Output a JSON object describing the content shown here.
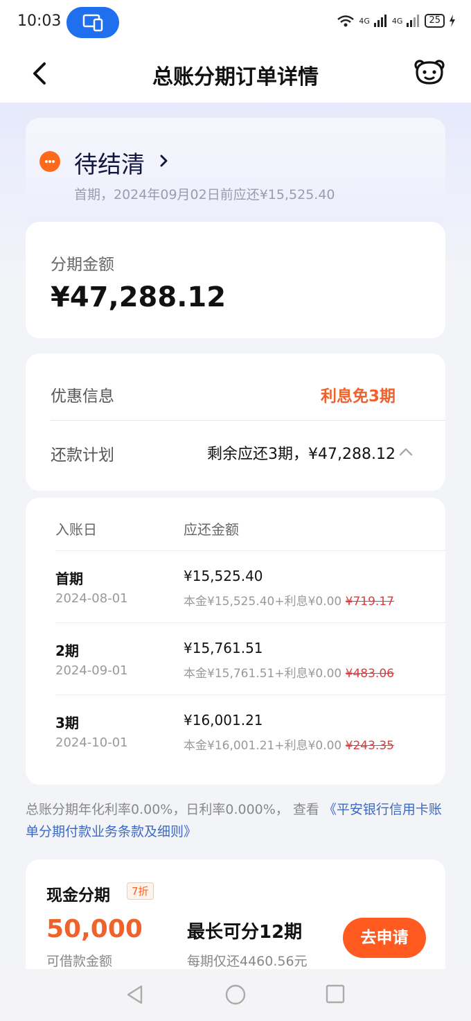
{
  "status_bar": {
    "time": "10:03",
    "battery": "25",
    "network1": "4G",
    "network2": "4G"
  },
  "header": {
    "title": "总账分期订单详情"
  },
  "status_card": {
    "status": "待结清",
    "subtitle": "首期，2024年09月02日前应还¥15,525.40"
  },
  "amount_card": {
    "label": "分期金额",
    "value": "¥47,288.12"
  },
  "info_card": {
    "promo_label": "优惠信息",
    "promo_value": "利息免3期",
    "plan_label": "还款计划",
    "plan_value": "剩余应还3期，¥47,288.12"
  },
  "schedule": {
    "col_date": "入账日",
    "col_amount": "应还金额",
    "rows": [
      {
        "period": "首期",
        "date": "2024-08-01",
        "amount": "¥15,525.40",
        "detail": "本金¥15,525.40+利息¥0.00",
        "original_interest": "¥719.17"
      },
      {
        "period": "2期",
        "date": "2024-09-01",
        "amount": "¥15,761.51",
        "detail": "本金¥15,761.51+利息¥0.00",
        "original_interest": "¥483.06"
      },
      {
        "period": "3期",
        "date": "2024-10-01",
        "amount": "¥16,001.21",
        "detail": "本金¥16,001.21+利息¥0.00",
        "original_interest": "¥243.35"
      }
    ]
  },
  "note": {
    "text": "总账分期年化利率0.00%，日利率0.000%， 查看",
    "link": "《平安银行信用卡账单分期付款业务条款及细则》"
  },
  "cash_card": {
    "title": "现金分期",
    "badge": "7折",
    "amount": "50,000",
    "amount_label": "可借款金额",
    "term": "最长可分12期",
    "monthly": "每期仅还4460.56元",
    "apply_label": "去申请"
  },
  "colors": {
    "accent_orange": "#f0622b",
    "button_orange": "#ff5a1f",
    "link_blue": "#3b69c4"
  }
}
